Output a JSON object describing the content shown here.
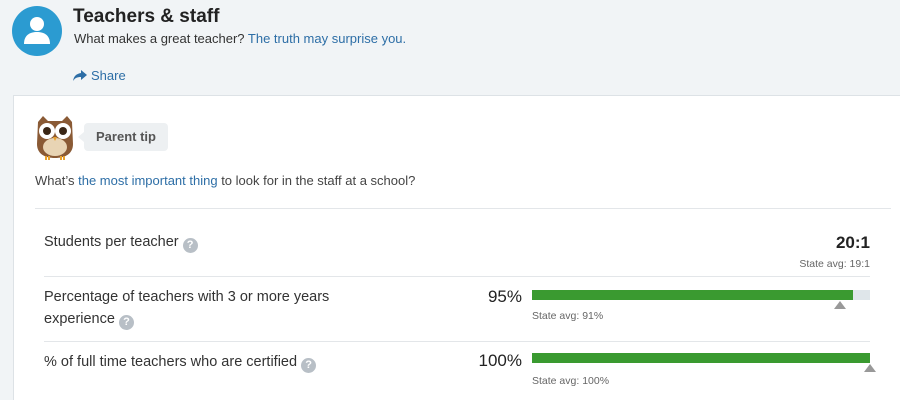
{
  "header": {
    "title": "Teachers & staff",
    "subtitle_prefix": "What makes a great teacher?",
    "subtitle_link": "The truth may surprise you.",
    "share_label": "Share"
  },
  "tip": {
    "label": "Parent tip",
    "question_prefix": "What’s ",
    "question_link": "the most important thing",
    "question_suffix": " to look for in the staff at a school?"
  },
  "rows": [
    {
      "label": "Students per teacher",
      "value": "20:1",
      "state_avg": "State avg: 19:1"
    },
    {
      "label_line1": "Percentage of teachers with 3 or more years",
      "label_line2": "experience",
      "value": "95%",
      "fill_percent": 95,
      "state_avg_percent": 91,
      "state_avg": "State avg: 91%"
    },
    {
      "label": "% of full time teachers who are certified",
      "value": "100%",
      "fill_percent": 100,
      "state_avg_percent": 100,
      "state_avg": "State avg: 100%"
    }
  ],
  "colors": {
    "brand_blue": "#2b9bd1",
    "link": "#2d6ea6",
    "bar_fill": "#3a9a30",
    "bar_track": "#dfe6ea"
  },
  "icons": [
    "person-icon",
    "share-arrow-icon",
    "owl-icon",
    "help-icon"
  ]
}
